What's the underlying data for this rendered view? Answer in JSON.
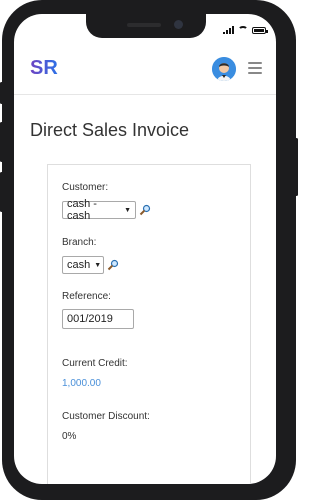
{
  "header": {
    "logo": "SR",
    "avatar_icon": "user-avatar-icon",
    "menu_icon": "hamburger-menu-icon"
  },
  "page": {
    "title": "Direct Sales Invoice"
  },
  "form": {
    "customer": {
      "label": "Customer:",
      "value": "cash - cash"
    },
    "branch": {
      "label": "Branch:",
      "value": "cash"
    },
    "reference": {
      "label": "Reference:",
      "value": "001/2019"
    },
    "current_credit": {
      "label": "Current Credit:",
      "value": "1,000.00"
    },
    "customer_discount": {
      "label": "Customer Discount:",
      "value": "0%"
    }
  },
  "colors": {
    "credit_value": "#4a90d9",
    "logo_start": "#6f42c1",
    "logo_end": "#2b72e8"
  }
}
